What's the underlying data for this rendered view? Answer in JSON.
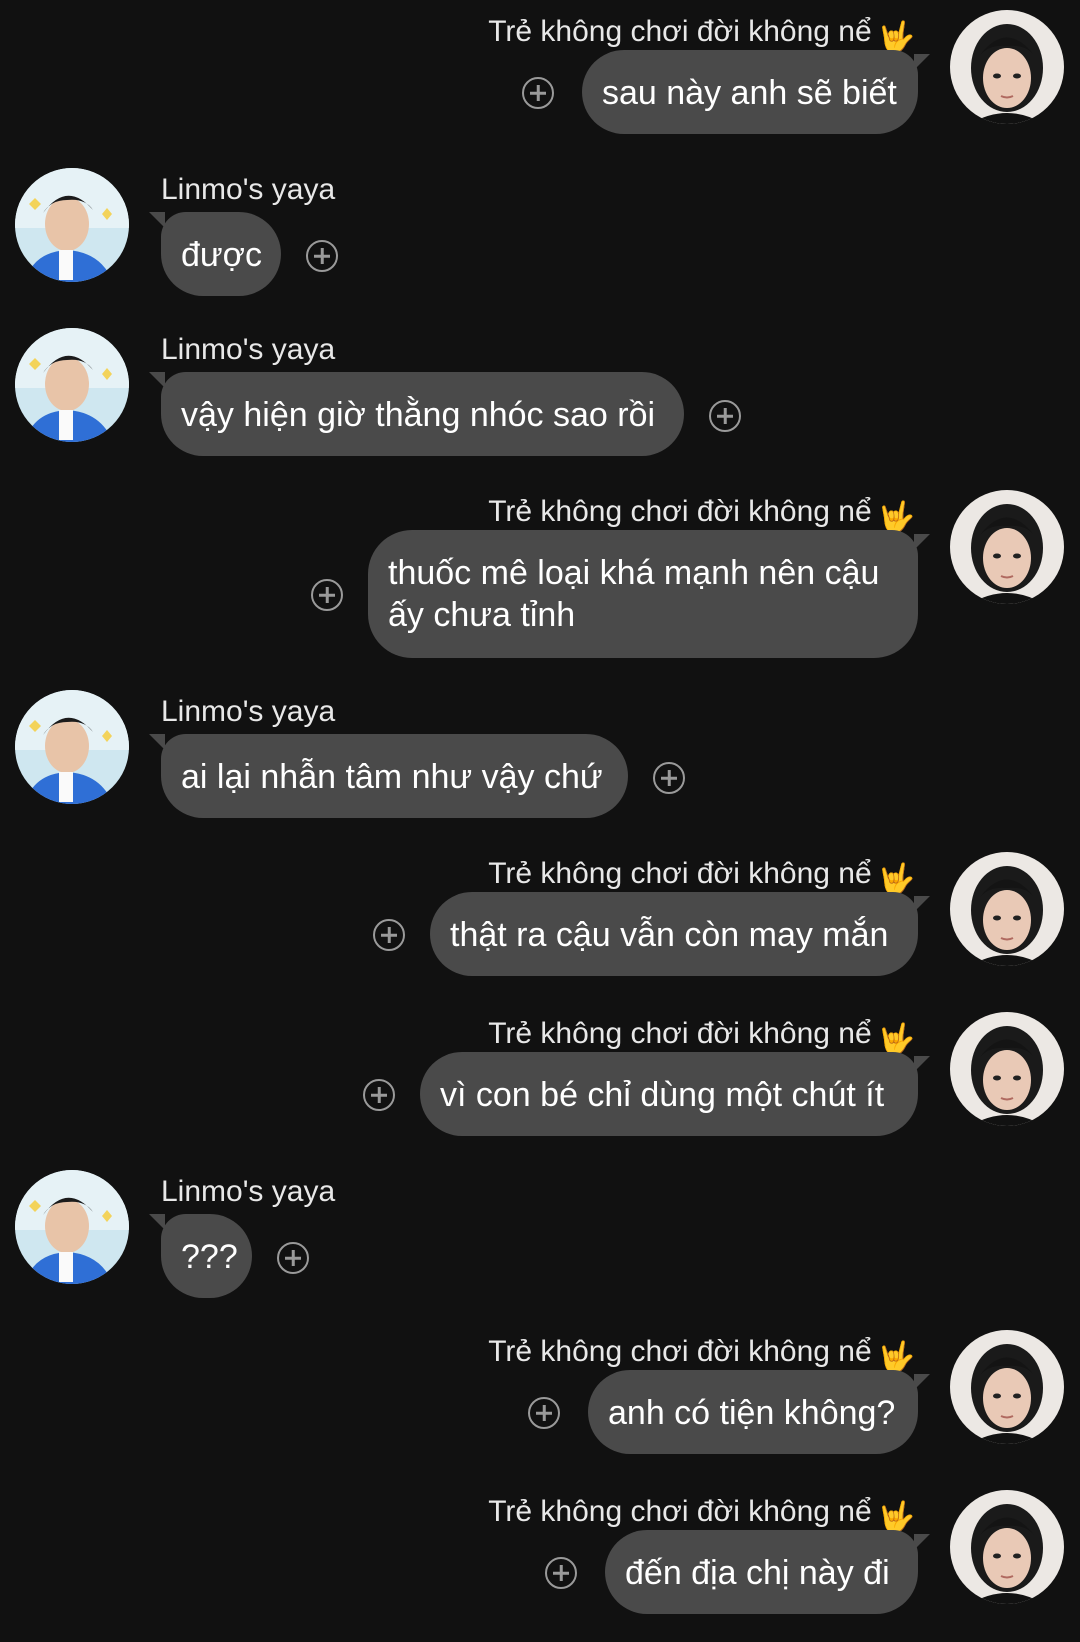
{
  "contacts": {
    "other": {
      "name": "Linmo's yaya",
      "avatar": "profile-photo-blue-jacket"
    },
    "me": {
      "name": "Trẻ không chơi đời không nể",
      "emoji": "🤟",
      "avatar": "profile-photo-black-shirt"
    }
  },
  "messages": [
    {
      "side": "right",
      "sender": "Trẻ không chơi đời không nể",
      "text": "sau này anh sẽ biết"
    },
    {
      "side": "left",
      "sender": "Linmo's yaya",
      "text": "được"
    },
    {
      "side": "left",
      "sender": "Linmo's yaya",
      "text": "vậy hiện giờ thằng nhóc sao rồi"
    },
    {
      "side": "right",
      "sender": "Trẻ không chơi đời không nể",
      "text": "thuốc mê loại khá mạnh nên cậu ấy chưa tỉnh"
    },
    {
      "side": "left",
      "sender": "Linmo's yaya",
      "text": "ai lại nhẫn tâm như vậy chứ"
    },
    {
      "side": "right",
      "sender": "Trẻ không chơi đời không nể",
      "text": "thật ra cậu vẫn còn may mắn"
    },
    {
      "side": "right",
      "sender": "Trẻ không chơi đời không nể",
      "text": "vì con bé chỉ dùng một chút ít"
    },
    {
      "side": "left",
      "sender": "Linmo's yaya",
      "text": "???"
    },
    {
      "side": "right",
      "sender": "Trẻ không chơi đời không nể",
      "text": "anh có tiện không?"
    },
    {
      "side": "right",
      "sender": "Trẻ không chơi đời không nể",
      "text": "đến địa chị này đi"
    }
  ],
  "colors": {
    "background": "#111111",
    "bubble": "#4a4a4a",
    "text": "#ffffff",
    "sender": "#e8e8e8",
    "react_icon": "#9a9a9a"
  },
  "icons": {
    "react": "add-reaction-icon"
  }
}
